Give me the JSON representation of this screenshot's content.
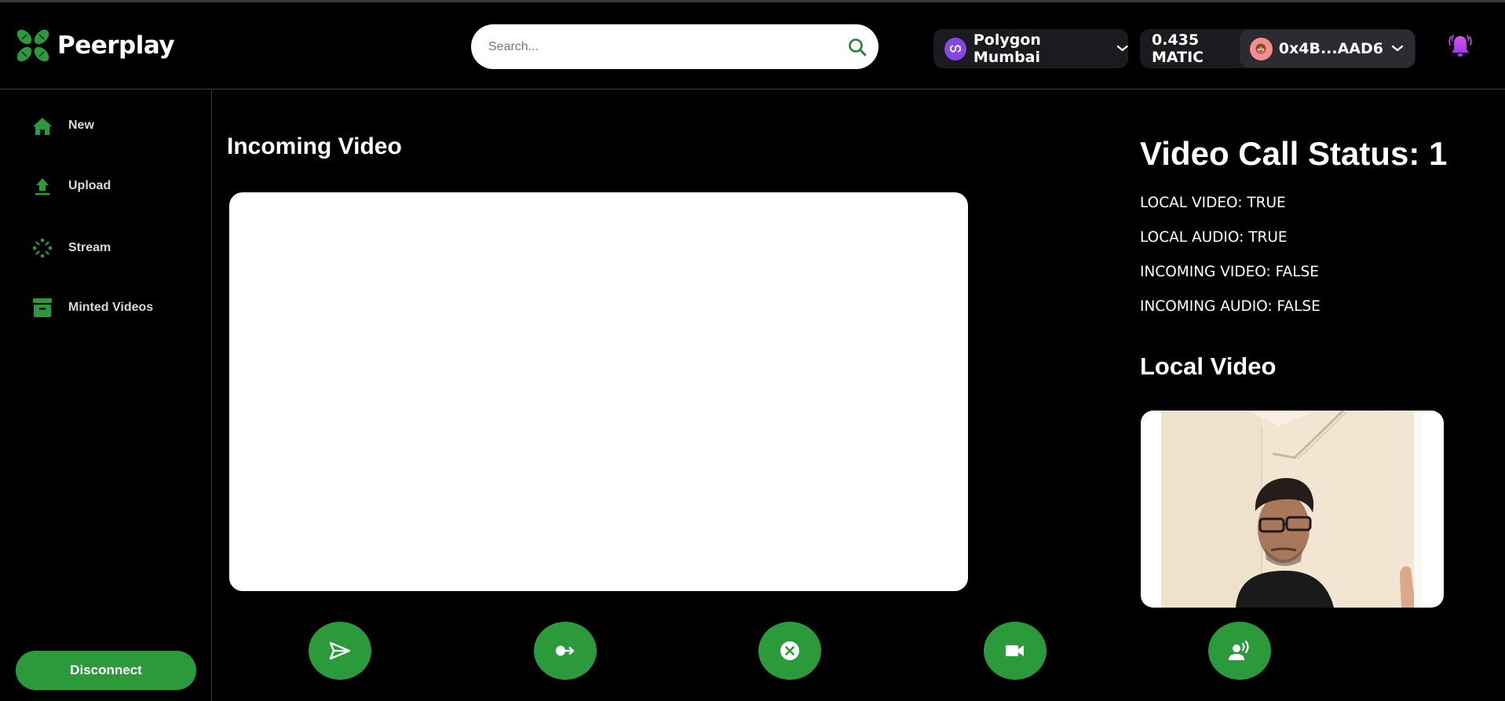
{
  "app": {
    "brand": "Peerplay",
    "brand_color": "#2a9a3a"
  },
  "header": {
    "search": {
      "placeholder": "Search...",
      "value": "",
      "icon": "search-icon"
    },
    "network": {
      "name": "Polygon Mumbai",
      "icon": "polygon-logo-icon",
      "color": "#8247e5"
    },
    "balance": "0.435 MATIC",
    "account": {
      "address": "0x4B...AAD6",
      "avatar": "monkey-avatar-icon"
    },
    "notifications_icon": "bell-icon"
  },
  "sidebar": {
    "items": [
      {
        "label": "New",
        "icon": "home-icon"
      },
      {
        "label": "Upload",
        "icon": "upload-icon"
      },
      {
        "label": "Stream",
        "icon": "stream-icon"
      },
      {
        "label": "Minted Videos",
        "icon": "archive-icon"
      }
    ],
    "disconnect_label": "Disconnect"
  },
  "main": {
    "incoming_title": "Incoming Video",
    "controls": [
      {
        "name": "send",
        "icon": "send-icon"
      },
      {
        "name": "join",
        "icon": "join-icon"
      },
      {
        "name": "end-call",
        "icon": "close-circle-icon"
      },
      {
        "name": "toggle-video",
        "icon": "video-camera-icon"
      },
      {
        "name": "toggle-audio",
        "icon": "speaking-person-icon"
      }
    ]
  },
  "status": {
    "title": "Video Call Status: 1",
    "lines": [
      "LOCAL VIDEO: TRUE",
      "LOCAL AUDIO: TRUE",
      "INCOMING VIDEO: FALSE",
      "INCOMING AUDIO: FALSE"
    ],
    "local_title": "Local Video"
  }
}
